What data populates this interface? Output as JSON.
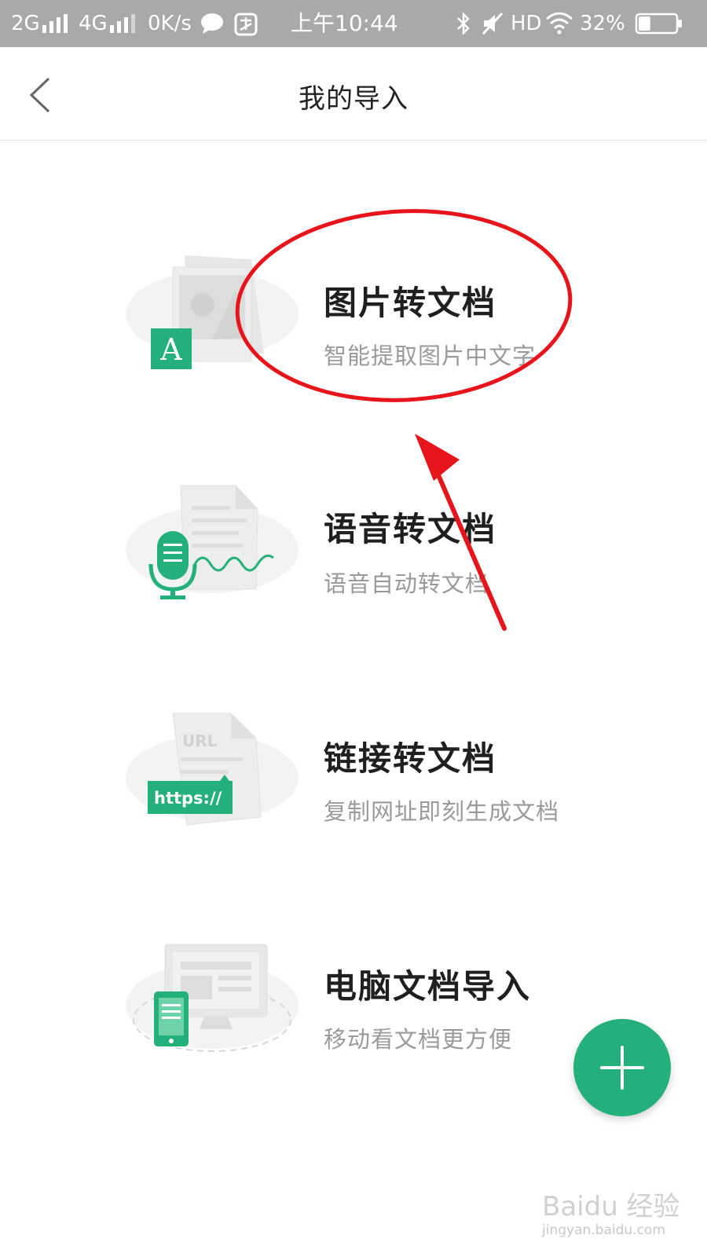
{
  "status_bar": {
    "network_2g": "2G",
    "network_4g": "4G",
    "speed": "0K/s",
    "time": "上午10:44",
    "hd": "HD",
    "battery": "32%",
    "battery_level": 0.32
  },
  "header": {
    "title": "我的导入"
  },
  "items": [
    {
      "title": "图片转文档",
      "subtitle": "智能提取图片中文字",
      "icon": "image-to-doc-icon"
    },
    {
      "title": "语音转文档",
      "subtitle": "语音自动转文档",
      "icon": "voice-to-doc-icon"
    },
    {
      "title": "链接转文档",
      "subtitle": "复制网址即刻生成文档",
      "icon": "link-to-doc-icon"
    },
    {
      "title": "电脑文档导入",
      "subtitle": "移动看文档更方便",
      "icon": "pc-doc-import-icon"
    }
  ],
  "illustrations": {
    "image_letter": "A",
    "url_text": "URL",
    "https_text": "https://"
  },
  "colors": {
    "accent_green": "#23b07a",
    "annotation_red": "#e8141b",
    "status_bar_bg": "#a9a9a9"
  },
  "watermark": {
    "brand": "Baidu 经验",
    "url": "jingyan.baidu.com"
  }
}
